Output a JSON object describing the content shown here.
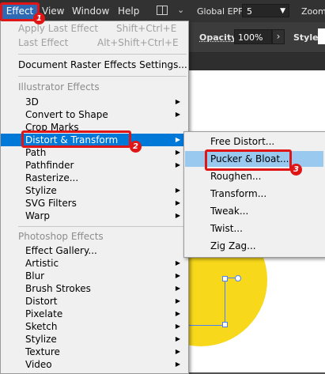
{
  "menubar": {
    "items": [
      "Effect",
      "View",
      "Window",
      "Help"
    ],
    "global_epf_label": "Global EPF:",
    "global_epf_value": "5",
    "zoom_label": "Zoom"
  },
  "controlbar": {
    "opacity_label": "Opacity:",
    "opacity_value": "100%",
    "style_label": "Style:"
  },
  "effect_menu": {
    "apply_last": {
      "label": "Apply Last Effect",
      "shortcut": "Shift+Ctrl+E"
    },
    "last_effect": {
      "label": "Last Effect",
      "shortcut": "Alt+Shift+Ctrl+E"
    },
    "raster_settings": "Document Raster Effects Settings...",
    "illustrator_header": "Illustrator Effects",
    "illustrator_items": [
      "3D",
      "Convert to Shape",
      "Crop Marks",
      "Distort & Transform",
      "Path",
      "Pathfinder",
      "Rasterize...",
      "Stylize",
      "SVG Filters",
      "Warp"
    ],
    "photoshop_header": "Photoshop Effects",
    "photoshop_items": [
      "Effect Gallery...",
      "Artistic",
      "Blur",
      "Brush Strokes",
      "Distort",
      "Pixelate",
      "Sketch",
      "Stylize",
      "Texture",
      "Video"
    ]
  },
  "distort_submenu": {
    "items": [
      "Free Distort...",
      "Pucker & Bloat...",
      "Roughen...",
      "Transform...",
      "Tweak...",
      "Twist...",
      "Zig Zag..."
    ]
  },
  "annotations": {
    "badge_1": "1",
    "badge_2": "2",
    "badge_3": "3"
  },
  "colors": {
    "highlight": "#0078d7",
    "submenu_highlight": "#99c9ef",
    "annotation_red": "#e01515",
    "shape_fill": "#f7d81a"
  }
}
